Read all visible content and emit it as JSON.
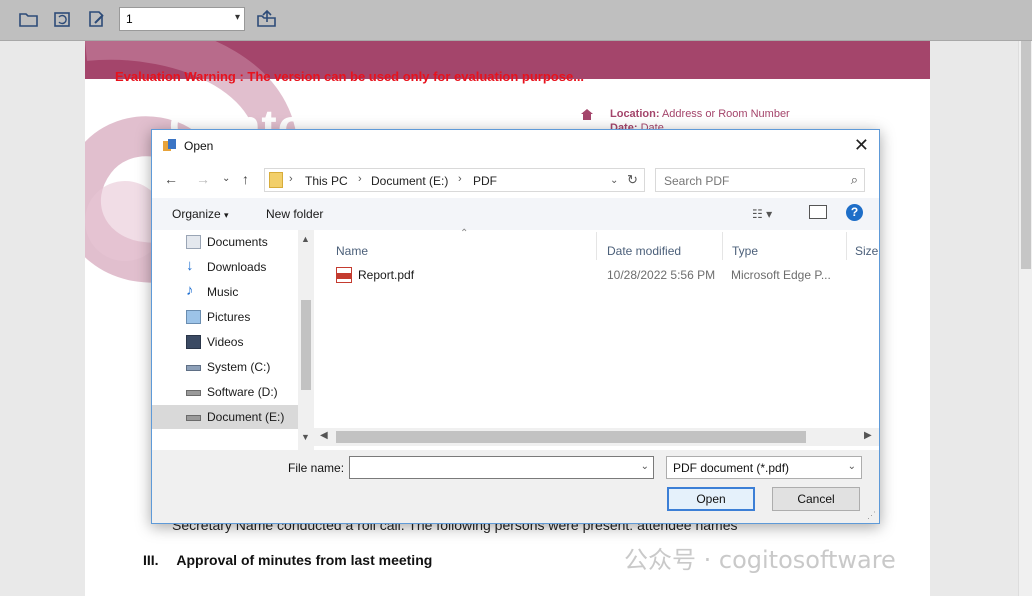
{
  "toolbar": {
    "icons": [
      "open-folder-icon",
      "reload-icon",
      "edit-icon",
      "upload-icon"
    ],
    "page_value": "1"
  },
  "document": {
    "eval_warning": "Evaluation Warning : The version can be used only for evaluation purpose...",
    "logo": "Contoso",
    "location_label": "Location:",
    "location_value": "Address or Room Number",
    "date_label": "Date:",
    "date_value": "Date",
    "roll_call_text": "Secretary Name conducted a roll call. The following persons were present: attendee names",
    "heading_number": "III.",
    "heading_text": "Approval of minutes from last meeting",
    "brand_color": "#a4456b",
    "warning_color": "#e8121d"
  },
  "watermark": "公众号 · cogitosoftware",
  "dialog": {
    "title": "Open",
    "breadcrumb": [
      "This PC",
      "Document (E:)",
      "PDF"
    ],
    "search_placeholder": "Search PDF",
    "organize_label": "Organize",
    "new_folder_label": "New folder",
    "nav_items": [
      {
        "label": "Documents",
        "icon": "documents-icon"
      },
      {
        "label": "Downloads",
        "icon": "downloads-icon"
      },
      {
        "label": "Music",
        "icon": "music-icon"
      },
      {
        "label": "Pictures",
        "icon": "pictures-icon"
      },
      {
        "label": "Videos",
        "icon": "videos-icon"
      },
      {
        "label": "System (C:)",
        "icon": "drive-icon"
      },
      {
        "label": "Software (D:)",
        "icon": "drive-icon"
      },
      {
        "label": "Document (E:)",
        "icon": "drive-icon",
        "selected": true
      }
    ],
    "columns": [
      "Name",
      "Date modified",
      "Type",
      "Size"
    ],
    "files": [
      {
        "name": "Report.pdf",
        "date_modified": "10/28/2022 5:56 PM",
        "type": "Microsoft Edge P..."
      }
    ],
    "file_name_label": "File name:",
    "file_name_value": "",
    "file_type": "PDF document (*.pdf)",
    "open_label": "Open",
    "cancel_label": "Cancel"
  }
}
